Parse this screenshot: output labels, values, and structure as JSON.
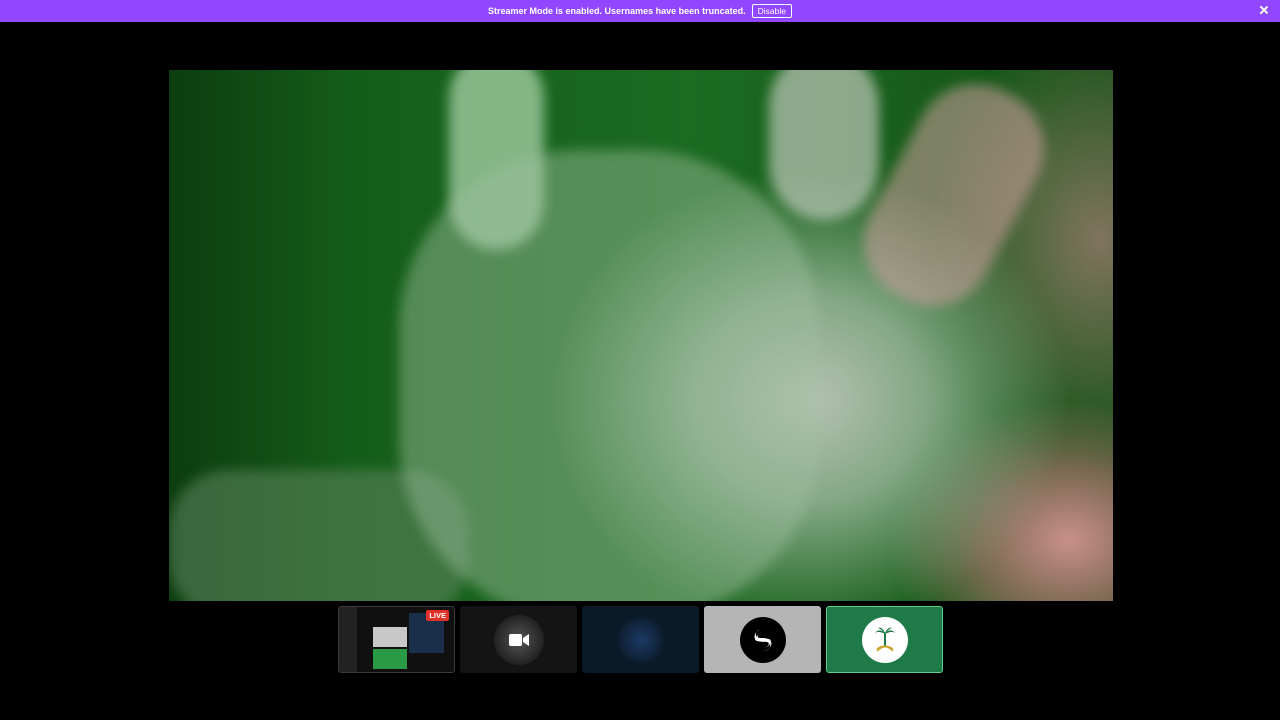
{
  "notice": {
    "message": "Streamer Mode is enabled. Usernames have been truncated.",
    "disable_label": "Disable",
    "close_icon": "close-icon"
  },
  "main_video": {
    "description_icon": "video-feed"
  },
  "thumbnails": [
    {
      "id": "screen-share",
      "badge": "LIVE",
      "kind": "screen"
    },
    {
      "id": "camera-off",
      "kind": "camera",
      "icon": "video-camera-icon"
    },
    {
      "id": "blue-avatar",
      "kind": "avatar"
    },
    {
      "id": "dark-logo-avatar",
      "kind": "avatar"
    },
    {
      "id": "emblem-avatar",
      "kind": "avatar",
      "selected": true
    }
  ],
  "colors": {
    "notice_bg": "#9147ff",
    "live_badge": "#e0312a",
    "selected_tile": "#1e7b48"
  }
}
